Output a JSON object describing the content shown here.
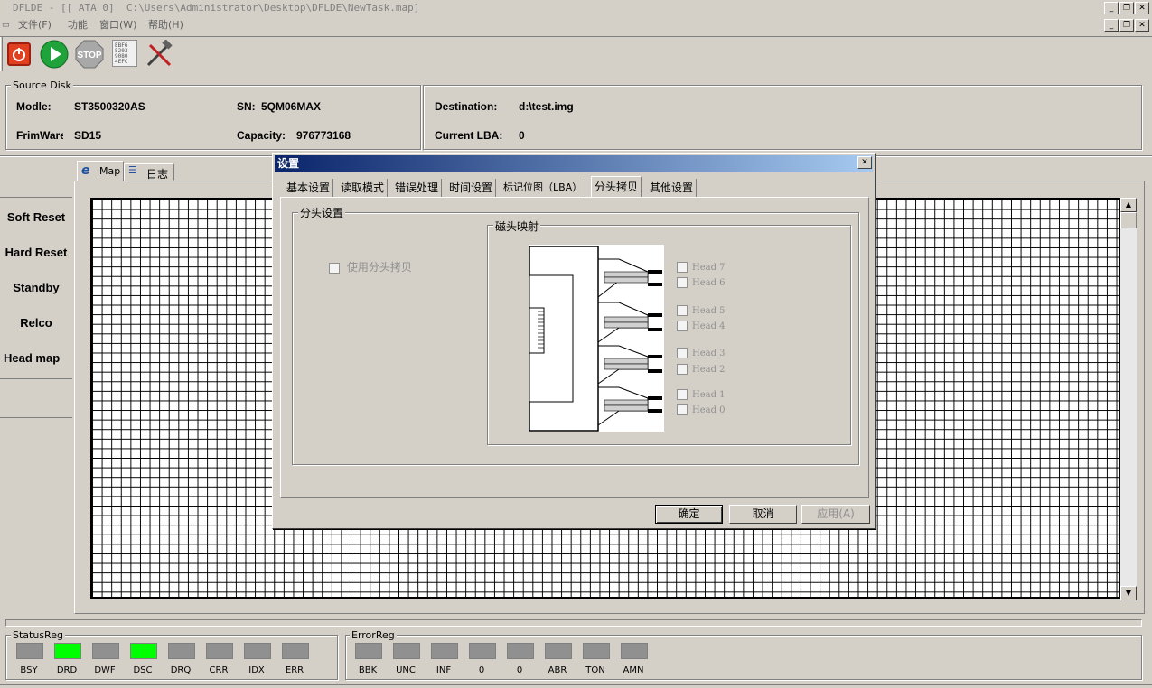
{
  "window": {
    "title": "DFLDE - [[ ATA 0]  C:\\Users\\Administrator\\Desktop\\DFLDE\\NewTask.map]"
  },
  "menu": {
    "items": [
      "文件(F)",
      "功能",
      "窗口(W)",
      "帮助(H)"
    ]
  },
  "toolbar": {
    "icons": [
      "power-icon",
      "play-icon",
      "stop-icon",
      "hex-icon",
      "tools-icon"
    ],
    "stop_label": "STOP"
  },
  "source_disk": {
    "group_label": "Source Disk",
    "model_label": "Modle:",
    "model_value": "ST3500320AS",
    "sn_label": "SN:",
    "sn_value": "5QM06MAX",
    "firmware_label": "FrimWare",
    "firmware_value": "SD15",
    "capacity_label": "Capacity:",
    "capacity_value": "976773168"
  },
  "destination": {
    "dest_label": "Destination:",
    "dest_value": "d:\\test.img",
    "lba_label": "Current LBA:",
    "lba_value": "0"
  },
  "side_buttons": [
    "Soft Reset",
    "Hard Reset",
    "Standby",
    "Relco",
    "Head map"
  ],
  "main_tabs": [
    "Map",
    "日志"
  ],
  "dialog": {
    "title": "设置",
    "close": "✕",
    "tabs": [
      "基本设置",
      "读取模式",
      "错误处理",
      "时间设置",
      "标记位图（LBA）",
      "分头拷贝",
      "其他设置"
    ],
    "active_tab": "分头拷贝",
    "group_label": "分头设置",
    "use_split_copy_label": "使用分头拷贝",
    "head_map_label": "磁头映射",
    "heads": [
      "Head 7",
      "Head 6",
      "Head 5",
      "Head 4",
      "Head 3",
      "Head 2",
      "Head 1",
      "Head 0"
    ],
    "ok_label": "确定",
    "cancel_label": "取消",
    "apply_label": "应用(A)"
  },
  "status_reg": {
    "label": "StatusReg",
    "leds": [
      {
        "name": "BSY",
        "on": false
      },
      {
        "name": "DRD",
        "on": true
      },
      {
        "name": "DWF",
        "on": false
      },
      {
        "name": "DSC",
        "on": true
      },
      {
        "name": "DRQ",
        "on": false
      },
      {
        "name": "CRR",
        "on": false
      },
      {
        "name": "IDX",
        "on": false
      },
      {
        "name": "ERR",
        "on": false
      }
    ]
  },
  "error_reg": {
    "label": "ErrorReg",
    "leds": [
      {
        "name": "BBK",
        "on": false
      },
      {
        "name": "UNC",
        "on": false
      },
      {
        "name": "INF",
        "on": false
      },
      {
        "name": "0",
        "on": false
      },
      {
        "name": "0",
        "on": false
      },
      {
        "name": "ABR",
        "on": false
      },
      {
        "name": "TON",
        "on": false
      },
      {
        "name": "AMN",
        "on": false
      }
    ]
  },
  "colors": {
    "led_on": "#00ff00",
    "led_off": "#909090",
    "title_gradient_start": "#0a246a"
  }
}
